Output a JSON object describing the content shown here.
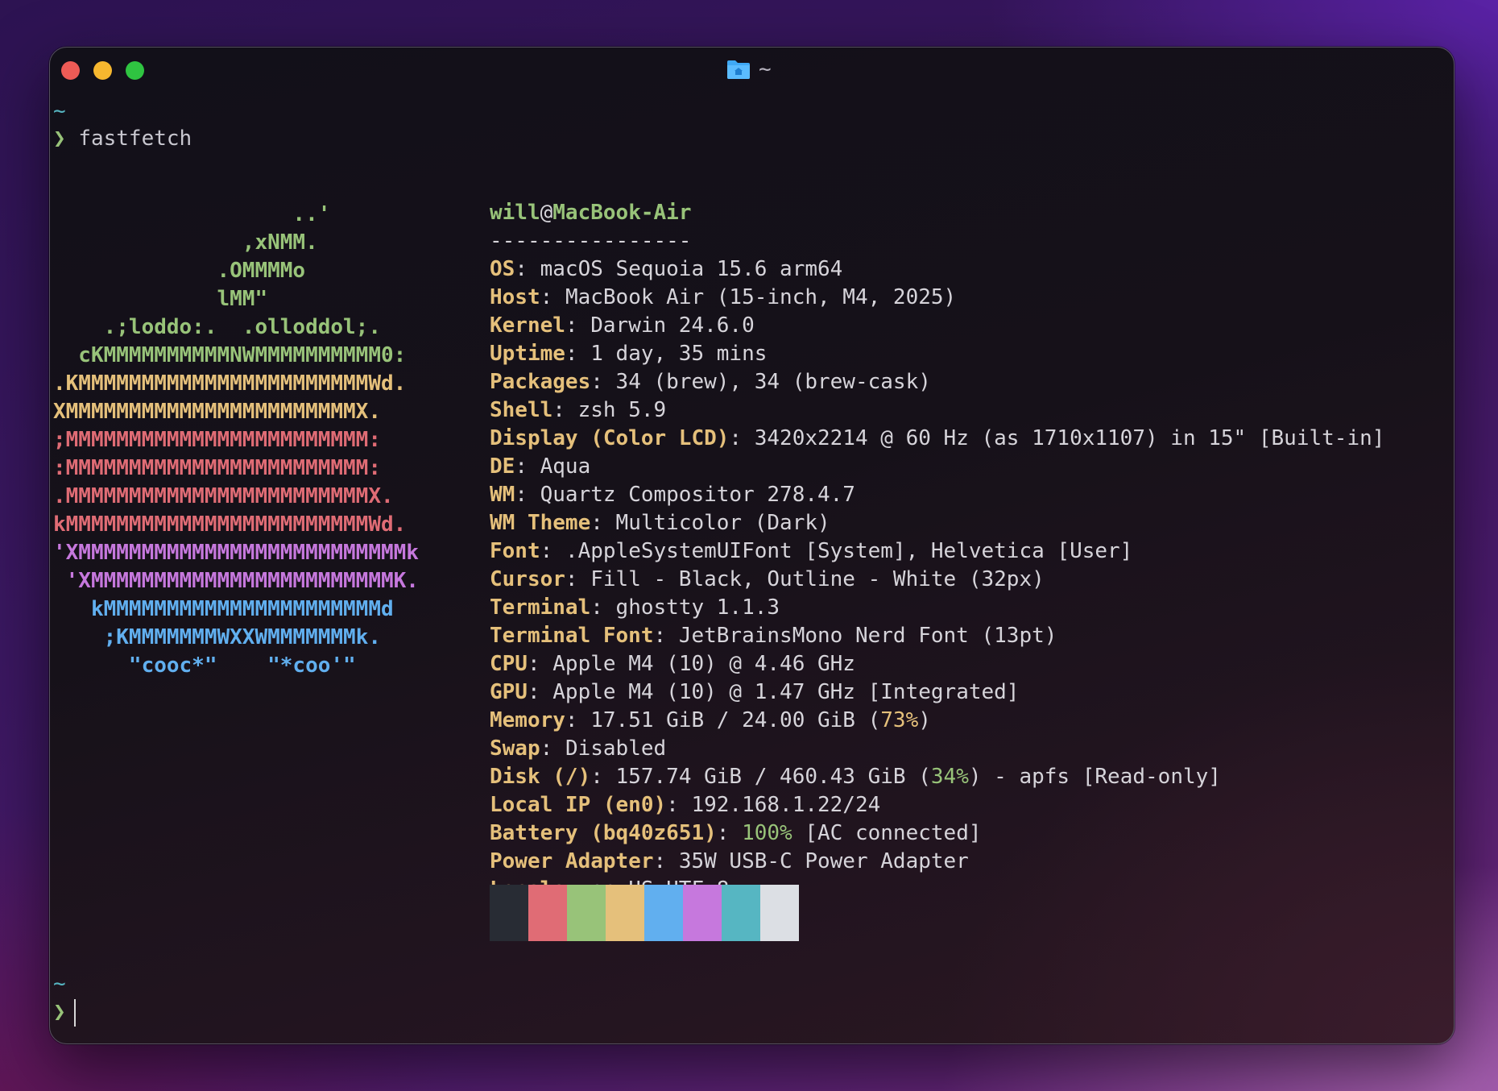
{
  "window": {
    "title": "~"
  },
  "terminal": {
    "prompt_dir_1": "~",
    "prompt_symbol_1": "❯",
    "command": "fastfetch",
    "prompt_dir_2": "~",
    "prompt_symbol_2": "❯"
  },
  "logo_lines": [
    "                   ..'",
    "               ,xNMM.",
    "             .OMMMMo",
    "             lMM\"",
    "    .;loddo:.  .olloddol;.",
    "  cKMMMMMMMMMMNWMMMMMMMMMM0:",
    ".KMMMMMMMMMMMMMMMMMMMMMMMWd.",
    "XMMMMMMMMMMMMMMMMMMMMMMMX.",
    ";MMMMMMMMMMMMMMMMMMMMMMMM:",
    ":MMMMMMMMMMMMMMMMMMMMMMMM:",
    ".MMMMMMMMMMMMMMMMMMMMMMMMX.",
    "kMMMMMMMMMMMMMMMMMMMMMMMMWd.",
    "'XMMMMMMMMMMMMMMMMMMMMMMMMMMk",
    " 'XMMMMMMMMMMMMMMMMMMMMMMMMK.",
    "   kMMMMMMMMMMMMMMMMMMMMMMd",
    "    ;KMMMMMMMWXXWMMMMMMMk.",
    "      \"cooc*\"    \"*coo'\""
  ],
  "header": {
    "user": "will",
    "at": "@",
    "host": "MacBook-Air",
    "separator": "----------------"
  },
  "info": {
    "os": {
      "key": "OS",
      "value": "macOS Sequoia 15.6 arm64"
    },
    "host": {
      "key": "Host",
      "value": "MacBook Air (15-inch, M4, 2025)"
    },
    "kernel": {
      "key": "Kernel",
      "value": "Darwin 24.6.0"
    },
    "uptime": {
      "key": "Uptime",
      "value": "1 day, 35 mins"
    },
    "packages": {
      "key": "Packages",
      "value": "34 (brew), 34 (brew-cask)"
    },
    "shell": {
      "key": "Shell",
      "value": "zsh 5.9"
    },
    "display": {
      "key": "Display (Color LCD)",
      "value": "3420x2214 @ 60 Hz (as 1710x1107) in 15\" [Built-in]"
    },
    "de": {
      "key": "DE",
      "value": "Aqua"
    },
    "wm": {
      "key": "WM",
      "value": "Quartz Compositor 278.4.7"
    },
    "wm_theme": {
      "key": "WM Theme",
      "value": "Multicolor (Dark)"
    },
    "font": {
      "key": "Font",
      "value": ".AppleSystemUIFont [System], Helvetica [User]"
    },
    "cursor": {
      "key": "Cursor",
      "value": "Fill - Black, Outline - White (32px)"
    },
    "terminal": {
      "key": "Terminal",
      "value": "ghostty 1.1.3"
    },
    "terminal_font": {
      "key": "Terminal Font",
      "value": "JetBrainsMono Nerd Font (13pt)"
    },
    "cpu": {
      "key": "CPU",
      "value": "Apple M4 (10) @ 4.46 GHz"
    },
    "gpu": {
      "key": "GPU",
      "value": "Apple M4 (10) @ 1.47 GHz [Integrated]"
    },
    "memory": {
      "key": "Memory",
      "value_pre": "17.51 GiB / 24.00 GiB (",
      "pct": "73%",
      "value_post": ")"
    },
    "swap": {
      "key": "Swap",
      "value": "Disabled"
    },
    "disk": {
      "key": "Disk (/)",
      "value_pre": "157.74 GiB / 460.43 GiB (",
      "pct": "34%",
      "value_post": ") - apfs [Read-only]"
    },
    "local_ip": {
      "key": "Local IP (en0)",
      "value": "192.168.1.22/24"
    },
    "battery": {
      "key": "Battery (bq40z651)",
      "pct": "100%",
      "value_post": " [AC connected]"
    },
    "power_adapter": {
      "key": "Power Adapter",
      "value": "35W USB-C Power Adapter"
    },
    "locale": {
      "key": "Locale",
      "value": "en_US.UTF-8"
    }
  },
  "colors": {
    "palette": [
      "#282c34",
      "#e06c75",
      "#98c379",
      "#e5c07b",
      "#61afef",
      "#c678dd",
      "#56b6c2",
      "#dcdfe4"
    ]
  }
}
